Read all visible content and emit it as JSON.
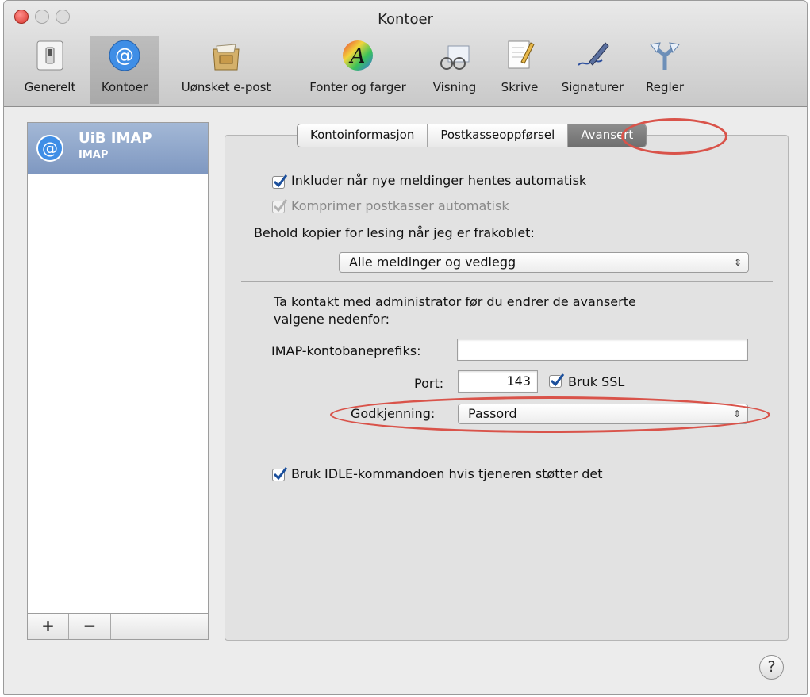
{
  "window": {
    "title": "Kontoer"
  },
  "toolbar": {
    "items": [
      {
        "label": "Generelt",
        "icon": "switch-icon"
      },
      {
        "label": "Kontoer",
        "icon": "at-sign-icon"
      },
      {
        "label": "Uønsket e-post",
        "icon": "junk-mail-icon"
      },
      {
        "label": "Fonter og farger",
        "icon": "font-colors-icon"
      },
      {
        "label": "Visning",
        "icon": "glasses-icon"
      },
      {
        "label": "Skrive",
        "icon": "compose-icon"
      },
      {
        "label": "Signaturer",
        "icon": "signature-pen-icon"
      },
      {
        "label": "Regler",
        "icon": "rules-arrows-icon"
      }
    ]
  },
  "sidebar": {
    "accounts": [
      {
        "name": "UiB IMAP",
        "type": "IMAP"
      }
    ],
    "add_label": "+",
    "remove_label": "−"
  },
  "tabs": {
    "items": [
      "Kontoinformasjon",
      "Postkasseoppførsel",
      "Avansert"
    ],
    "selected": "Avansert"
  },
  "advanced": {
    "include_auto_fetch": {
      "label": "Inkluder når nye meldinger hentes automatisk",
      "checked": true
    },
    "compact_mailboxes": {
      "label": "Komprimer postkasser automatisk",
      "checked": true,
      "enabled": false
    },
    "keep_copies_label": "Behold kopier for lesing når jeg er frakoblet:",
    "keep_copies_value": "Alle meldinger og vedlegg",
    "admin_note_line1": "Ta kontakt med administrator før du endrer de avanserte",
    "admin_note_line2": "valgene nedenfor:",
    "imap_prefix_label": "IMAP-kontobaneprefiks:",
    "imap_prefix_value": "",
    "port_label": "Port:",
    "port_value": "143",
    "use_ssl": {
      "label": "Bruk SSL",
      "checked": true
    },
    "auth_label": "Godkjenning:",
    "auth_value": "Passord",
    "idle": {
      "label": "Bruk IDLE-kommandoen hvis tjeneren støtter det",
      "checked": true
    }
  },
  "help_label": "?",
  "colors": {
    "annotation_oval": "#d9534a",
    "selection": "#7f98c1",
    "checkmark": "#1b4f9c"
  }
}
